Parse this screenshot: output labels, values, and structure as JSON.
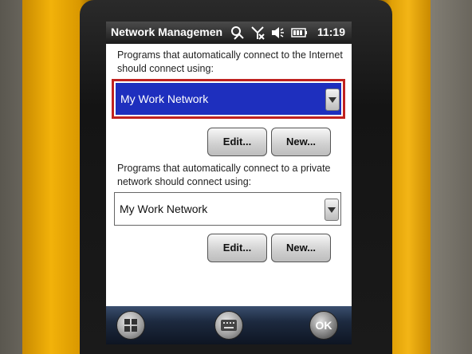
{
  "window": {
    "title": "Network Managemen",
    "clock": "11:19"
  },
  "status_icons": [
    "connectivity-icon",
    "no-signal-icon",
    "volume-icon",
    "battery-icon"
  ],
  "internet": {
    "label": "Programs that automatically connect to the Internet should connect using:",
    "selected": "My Work Network",
    "edit_label": "Edit...",
    "new_label": "New..."
  },
  "private": {
    "label": "Programs that automatically connect to a private network should connect using:",
    "selected": "My Work Network",
    "edit_label": "Edit...",
    "new_label": "New..."
  },
  "softkeys": {
    "start_icon": "windows-start-icon",
    "keyboard_icon": "keyboard-icon",
    "ok_label": "OK"
  },
  "colors": {
    "highlight": "#1e2fbe",
    "focus_outline": "#c0221f",
    "device_case": "#f2b20a"
  }
}
